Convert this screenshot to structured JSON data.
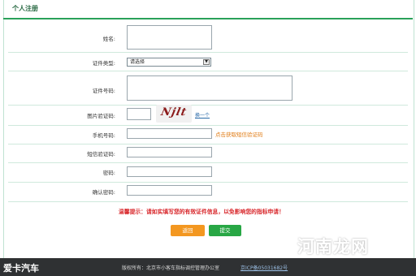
{
  "page": {
    "title": "个人注册"
  },
  "form": {
    "name_label": "姓名:",
    "id_type_label": "证件类型:",
    "id_type_selected": "请选择",
    "id_number_label": "证件号码:",
    "captcha_label": "图片验证码:",
    "captcha_text": "Njlt",
    "refresh_label": "换一个",
    "phone_label": "手机号码:",
    "get_sms_label": "点击获取短信验证码",
    "sms_label": "短信验证码:",
    "password_label": "密码:",
    "confirm_label": "确认密码:"
  },
  "warning": "温馨提示：请如实填写您的有效证件信息，以免影响您的指标申请！",
  "buttons": {
    "back": "返回",
    "submit": "提交"
  },
  "footer": {
    "logo": "爱卡汽车",
    "copyright": "版权所有：北京市小客车指标调控管理办公室",
    "icp": "京ICP备05031682号"
  },
  "watermark": "河南龙网"
}
